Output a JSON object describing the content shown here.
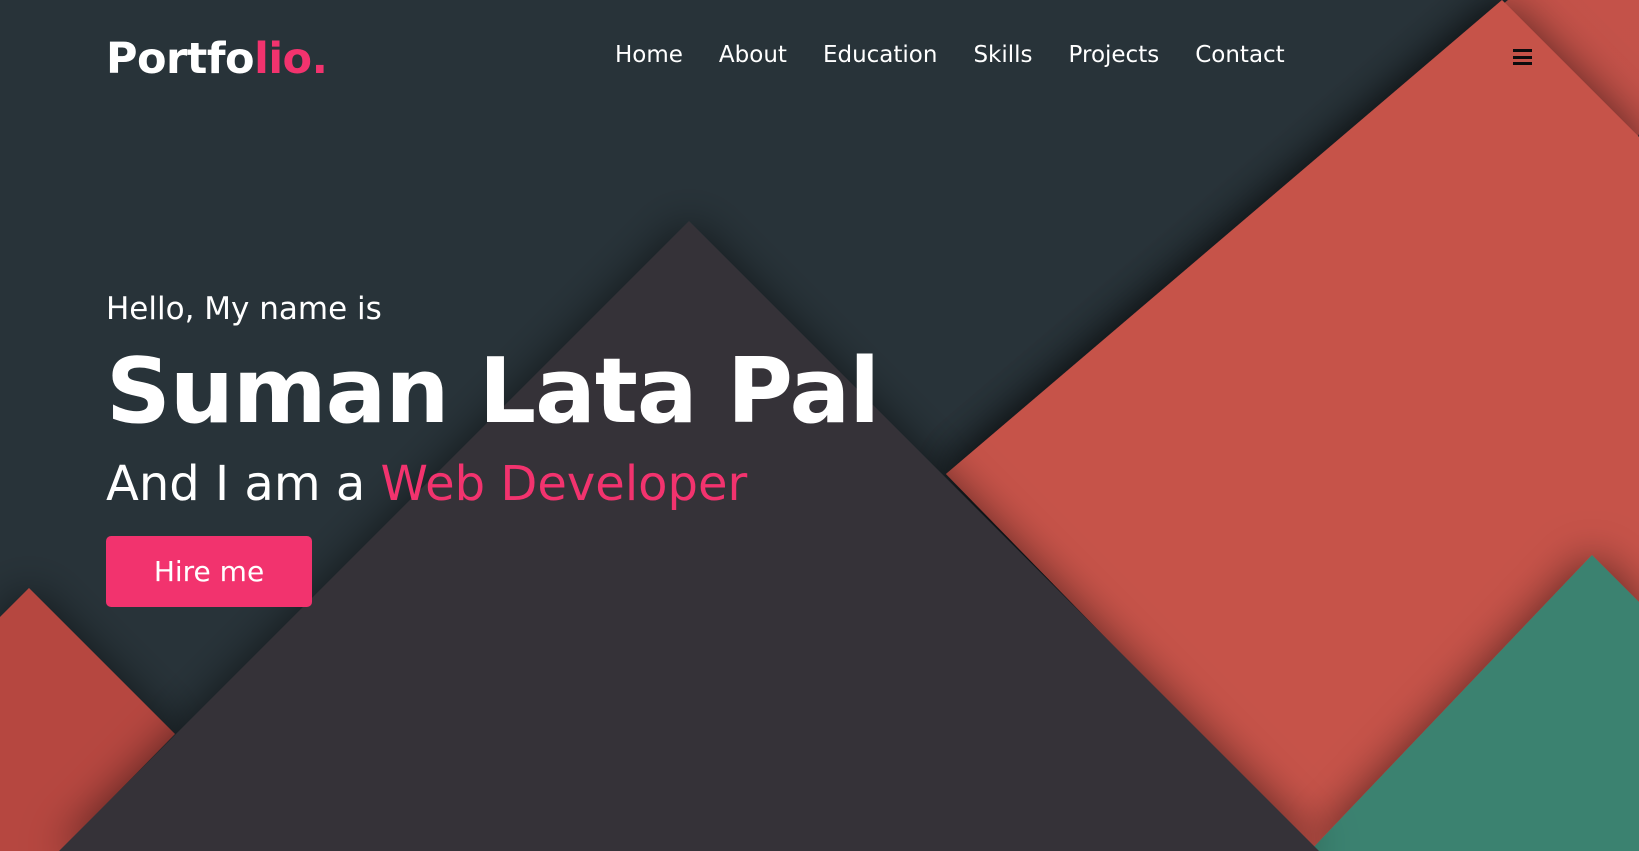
{
  "colors": {
    "accent": "#f2336e",
    "background": "#283339",
    "charcoal_shape": "#343339",
    "red_shape": "#c6534a",
    "red_shape_dark": "#b6473f",
    "green_shape": "#3b8270"
  },
  "brand": {
    "prefix": "Portfo",
    "accent": "lio."
  },
  "nav": {
    "items": [
      {
        "label": "Home"
      },
      {
        "label": "About"
      },
      {
        "label": "Education"
      },
      {
        "label": "Skills"
      },
      {
        "label": "Projects"
      },
      {
        "label": "Contact"
      }
    ],
    "menu_icon": "hamburger-menu-icon"
  },
  "hero": {
    "greeting": "Hello, My name is",
    "name": "Suman Lata Pal",
    "role_prefix": "And I am a ",
    "role": "Web Developer",
    "cta_label": "Hire me"
  }
}
